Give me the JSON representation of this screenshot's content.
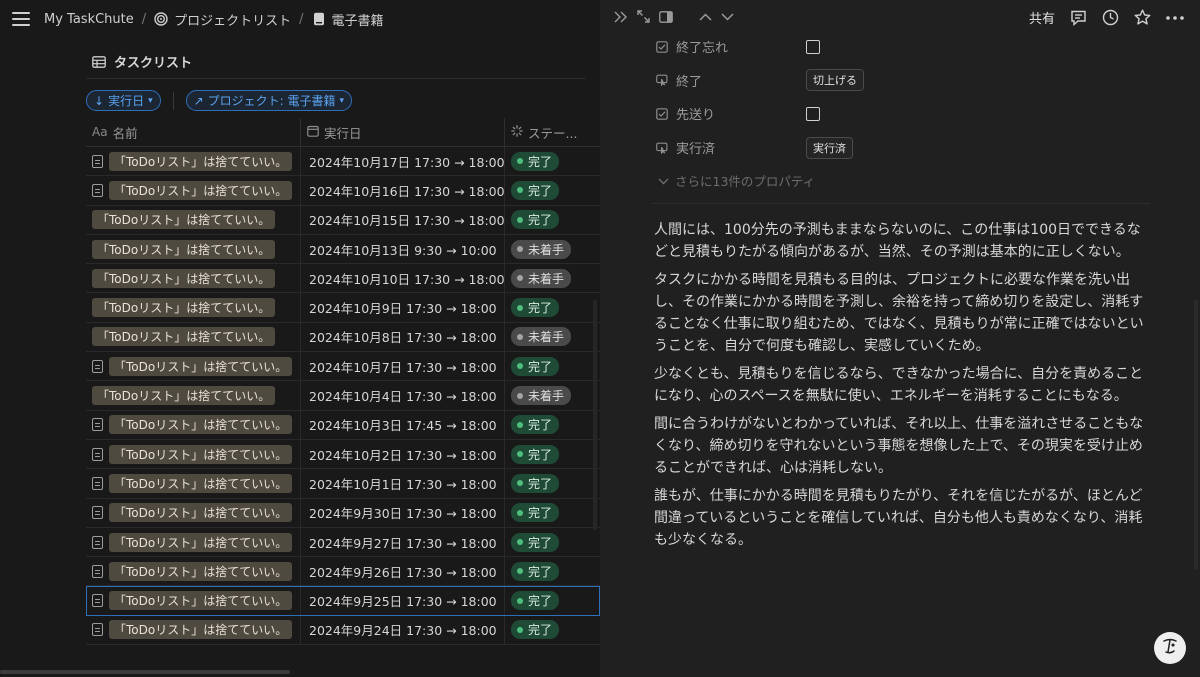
{
  "breadcrumb": {
    "items": [
      "My TaskChute",
      "プロジェクトリスト",
      "電子書籍"
    ],
    "separator": "/"
  },
  "database": {
    "title": "タスクリスト",
    "filters": [
      {
        "label": "実行日",
        "arrow": "↓"
      },
      {
        "label": "プロジェクト: 電子書籍",
        "arrow": "↗"
      }
    ],
    "columns": {
      "name_icon": "Aa",
      "name": "名前",
      "date": "実行日",
      "status": "ステー..."
    },
    "rows": [
      {
        "name": "「ToDoリスト」は捨てていい。",
        "icon": true,
        "date": "2024年10月17日 17:30 → 18:00",
        "status": "完了"
      },
      {
        "name": "「ToDoリスト」は捨てていい。",
        "icon": true,
        "date": "2024年10月16日 17:30 → 18:00",
        "status": "完了"
      },
      {
        "name": "「ToDoリスト」は捨てていい。",
        "icon": false,
        "date": "2024年10月15日 17:30 → 18:00",
        "status": "完了"
      },
      {
        "name": "「ToDoリスト」は捨てていい。",
        "icon": false,
        "date": "2024年10月13日 9:30 → 10:00",
        "status": "未着手"
      },
      {
        "name": "「ToDoリスト」は捨てていい。",
        "icon": false,
        "date": "2024年10月10日 17:30 → 18:00",
        "status": "未着手"
      },
      {
        "name": "「ToDoリスト」は捨てていい。",
        "icon": false,
        "date": "2024年10月9日 17:30 → 18:00",
        "status": "完了"
      },
      {
        "name": "「ToDoリスト」は捨てていい。",
        "icon": false,
        "date": "2024年10月8日 17:30 → 18:00",
        "status": "未着手"
      },
      {
        "name": "「ToDoリスト」は捨てていい。",
        "icon": true,
        "date": "2024年10月7日 17:30 → 18:00",
        "status": "完了"
      },
      {
        "name": "「ToDoリスト」は捨てていい。",
        "icon": false,
        "date": "2024年10月4日 17:30 → 18:00",
        "status": "未着手"
      },
      {
        "name": "「ToDoリスト」は捨てていい。",
        "icon": true,
        "date": "2024年10月3日 17:45 → 18:00",
        "status": "完了"
      },
      {
        "name": "「ToDoリスト」は捨てていい。",
        "icon": true,
        "date": "2024年10月2日 17:30 → 18:00",
        "status": "完了"
      },
      {
        "name": "「ToDoリスト」は捨てていい。",
        "icon": true,
        "date": "2024年10月1日 17:30 → 18:00",
        "status": "完了"
      },
      {
        "name": "「ToDoリスト」は捨てていい。",
        "icon": true,
        "date": "2024年9月30日 17:30 → 18:00",
        "status": "完了"
      },
      {
        "name": "「ToDoリスト」は捨てていい。",
        "icon": true,
        "date": "2024年9月27日 17:30 → 18:00",
        "status": "完了"
      },
      {
        "name": "「ToDoリスト」は捨てていい。",
        "icon": true,
        "date": "2024年9月26日 17:30 → 18:00",
        "status": "完了"
      },
      {
        "name": "「ToDoリスト」は捨てていい。",
        "icon": true,
        "date": "2024年9月25日 17:30 → 18:00",
        "status": "完了",
        "selected": true
      },
      {
        "name": "「ToDoリスト」は捨てていい。",
        "icon": true,
        "date": "2024年9月24日 17:30 → 18:00",
        "status": "完了"
      }
    ]
  },
  "status_colors": {
    "完了": "#1f4a36",
    "未着手": "#4a4a4a"
  },
  "detail": {
    "toolbar": {
      "share": "共有"
    },
    "properties": [
      {
        "name": "終了忘れ",
        "kind": "checkbox",
        "icon": "checkbox-icon"
      },
      {
        "name": "終了",
        "kind": "button",
        "value": "切上げる",
        "icon": "cursor-click-icon"
      },
      {
        "name": "先送り",
        "kind": "checkbox",
        "icon": "checkbox-icon"
      },
      {
        "name": "実行済",
        "kind": "button",
        "value": "実行済",
        "icon": "cursor-click-icon"
      }
    ],
    "more_properties": "さらに13件のプロパティ",
    "paragraphs": [
      "人間には、100分先の予測もままならないのに、この仕事は100日でできるなどと見積もりたがる傾向があるが、当然、その予測は基本的に正しくない。",
      "タスクにかかる時間を見積もる目的は、プロジェクトに必要な作業を洗い出し、その作業にかかる時間を予測し、余裕を持って締め切りを設定し、消耗することなく仕事に取り組むため、ではなく、見積もりが常に正確ではないということを、自分で何度も確認し、実感していくため。",
      "少なくとも、見積もりを信じるなら、できなかった場合に、自分を責めることになり、心のスペースを無駄に使い、エネルギーを消耗することにもなる。",
      "間に合うわけがないとわかっていれば、それ以上、仕事を溢れさせることもなくなり、締め切りを守れないという事態を想像した上で、その現実を受け止めることができれば、心は消耗しない。",
      "誰もが、仕事にかかる時間を見積もりたがり、それを信じたがるが、ほとんど間違っているということを確信していれば、自分も他人も責めなくなり、消耗も少なくなる。"
    ]
  }
}
